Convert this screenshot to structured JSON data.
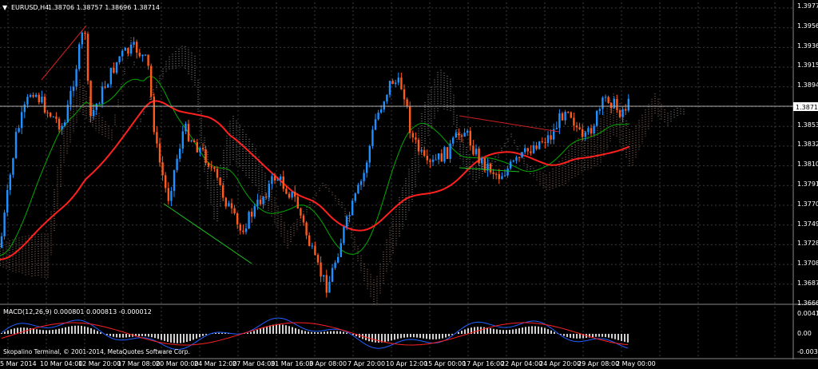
{
  "chart": {
    "header": {
      "menu_glyph": "▼",
      "symbol": "EURUSD,H4",
      "ohlc": "1.38706 1.38757 1.38696 1.38714"
    },
    "price_axis": [
      "1.39770",
      "1.39565",
      "1.39360",
      "1.39150",
      "1.38945",
      "1.38530",
      "1.38320",
      "1.38105",
      "1.37910",
      "1.37700",
      "1.37495",
      "1.37285",
      "1.37080",
      "1.36870",
      "1.36665"
    ],
    "current_price": "1.38714",
    "time_axis": [
      "5 Mar 2014",
      "10 Mar 04:00",
      "12 Mar 20:00",
      "17 Mar 08:00",
      "20 Mar 00:00",
      "24 Mar 12:00",
      "27 Mar 04:00",
      "31 Mar 16:00",
      "3 Apr 08:00",
      "7 Apr 20:00",
      "10 Apr 12:00",
      "15 Apr 00:00",
      "17 Apr 16:00",
      "22 Apr 04:00",
      "24 Apr 20:00",
      "29 Apr 08:00",
      "2 May 00:00"
    ],
    "copyright": "Skopalino Terminal, © 2001-2014, MetaQuotes Software Corp."
  },
  "macd": {
    "label": "MACD(12,26,9) 0.000801 0.000813 -0.000012",
    "axis": [
      "0.00416",
      "0.00",
      "-0.003766"
    ]
  },
  "colors": {
    "background": "#000000",
    "grid": "#3a3a3a",
    "bull_candle": "#1e90ff",
    "bear_candle": "#ff5a1e",
    "ma_fast": "#00aa00",
    "ma_slow": "#ff2020",
    "cloud": "#d8a080",
    "cloud_light": "#cccccc",
    "macd_hist": "#d0d0d0",
    "macd_line": "#2060ff",
    "signal_line": "#ff2020"
  }
}
